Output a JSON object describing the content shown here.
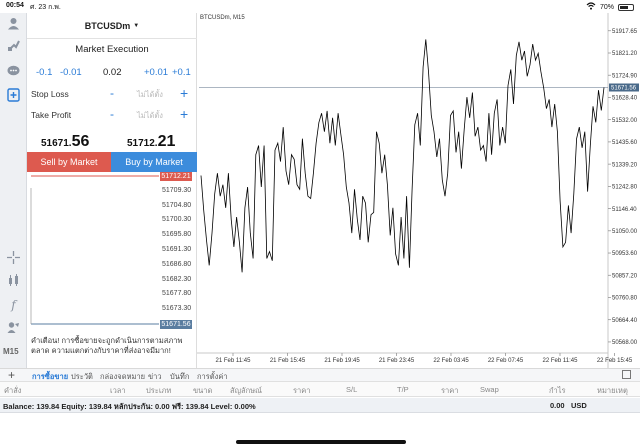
{
  "status_bar": {
    "time": "00:54",
    "date": "ศ. 23 ก.พ.",
    "battery": "70%",
    "battery_level": 0.7
  },
  "left_toolbar": {
    "icons": [
      "account-icon",
      "trade-icon",
      "chat-icon",
      "new-order-icon",
      "crosshair-icon",
      "indicators-icon",
      "function-icon",
      "objects-icon"
    ],
    "timeframe": "M15"
  },
  "order_panel": {
    "symbol": "BTCUSDm",
    "execution": "Market Execution",
    "volume": {
      "minus1": "-0.1",
      "minus2": "-0.01",
      "value": "0.02",
      "plus2": "+0.01",
      "plus1": "+0.1"
    },
    "stop_loss": {
      "label": "Stop Loss",
      "placeholder": "ไม่ได้ตั้ง"
    },
    "take_profit": {
      "label": "Take Profit",
      "placeholder": "ไม่ได้ตั้ง"
    },
    "bid": {
      "prefix": "51671.",
      "big": "56"
    },
    "ask": {
      "prefix": "51712.",
      "big": "21"
    },
    "sell_label": "Sell by Market",
    "buy_label": "Buy by Market",
    "depth_ticks": [
      "51712.21",
      "51709.30",
      "51704.80",
      "51700.30",
      "51695.80",
      "51691.30",
      "51686.80",
      "51682.30",
      "51677.80",
      "51673.30",
      "51671.56"
    ],
    "notice": "คำเตือน! การซื้อขายจะถูกดำเนินการตามสภาพตลาด ความแตกต่างกับราคาที่ส่งอาจมีมาก!"
  },
  "chart": {
    "title": "BTCUSDm, M15",
    "current_price_label": "51671.56",
    "colors": {
      "line": "#000000",
      "grid": "#c8c8c8",
      "current": "#5a6f85",
      "bid_tag": "#4a6a8a"
    }
  },
  "chart_data": {
    "type": "line",
    "title": "BTCUSDm, M15",
    "y_ticks": [
      51917.65,
      51821.2,
      51724.9,
      51628.4,
      51532.0,
      51435.6,
      51339.2,
      51242.8,
      51146.4,
      51050.0,
      50953.6,
      50857.2,
      50760.8,
      50664.4,
      50568.0
    ],
    "x_ticks": [
      "21 Feb 11:45",
      "21 Feb 15:45",
      "21 Feb 19:45",
      "21 Feb 23:45",
      "22 Feb 03:45",
      "22 Feb 07:45",
      "22 Feb 11:45",
      "22 Feb 15:45"
    ],
    "ylim": [
      50520,
      51960
    ],
    "current_price": 51671.56,
    "values": [
      51290,
      51140,
      51010,
      50900,
      51040,
      51210,
      51300,
      51200,
      51250,
      51150,
      51300,
      51100,
      50980,
      51110,
      51000,
      50870,
      51150,
      51240,
      51040,
      50930,
      51380,
      51420,
      51240,
      51420,
      50930,
      50960,
      50920,
      51400,
      51430,
      51350,
      51500,
      51310,
      51250,
      51380,
      51360,
      51250,
      51230,
      51450,
      51300,
      51200,
      51190,
      51300,
      51430,
      51520,
      51560,
      51480,
      51570,
      51430,
      51540,
      51420,
      51560,
      51470,
      51380,
      51240,
      51170,
      51040,
      51230,
      51100,
      51010,
      51200,
      51170,
      51000,
      51120,
      51130,
      51480,
      51430,
      51300,
      51380,
      51250,
      51030,
      51150,
      50950,
      50900,
      51110,
      50930,
      51200,
      50890,
      51230,
      51510,
      51560,
      51420,
      51760,
      51880,
      51740,
      51550,
      51480,
      51370,
      51450,
      51270,
      51200,
      51300,
      51550,
      51570,
      51390,
      51480,
      51320,
      51490,
      51630,
      51540,
      51650,
      51460,
      51500,
      51400,
      51420,
      51350,
      51560,
      51380,
      51560,
      51620,
      51420,
      51500,
      51430,
      51680,
      51750,
      51600,
      51810,
      51870,
      51790,
      51830,
      51720,
      51770,
      51860,
      51790,
      51820,
      51740,
      51670,
      51580,
      51620,
      51500,
      51600,
      51480,
      51180,
      50980,
      51000,
      51160,
      51040,
      51210,
      51450,
      51500,
      51410,
      51480,
      51220,
      51420,
      51590,
      51520,
      51660,
      51572,
      51672
    ]
  },
  "bottom_panel": {
    "tabs": [
      "การซื้อขาย",
      "ประวัติ",
      "กล่องจดหมาย",
      "ข่าว",
      "บันทึก",
      "การตั้งค่า"
    ],
    "columns": [
      "คำสั่ง",
      "เวลา",
      "ประเภท",
      "ขนาด",
      "สัญลักษณ์",
      "ราคา",
      "S/L",
      "T/P",
      "ราคา",
      "Swap",
      "กำไร",
      "หมายเหตุ"
    ],
    "balance_text": "Balance: 139.84 Equity: 139.84 หลักประกัน: 0.00 ฟรี: 139.84 Level: 0.00%",
    "profit": "0.00",
    "currency": "USD"
  }
}
